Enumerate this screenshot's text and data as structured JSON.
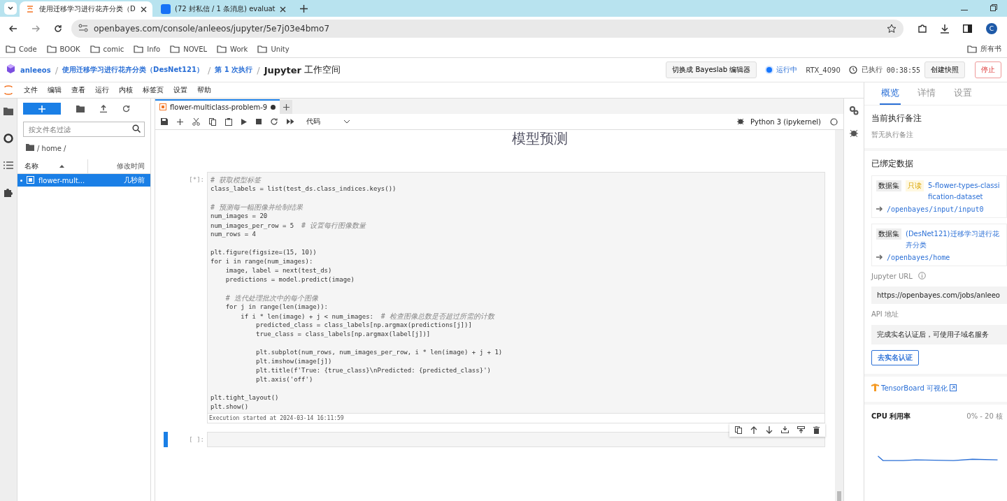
{
  "browser": {
    "tabs": [
      {
        "title": "使用迁移学习进行花卉分类（D",
        "selected": true
      },
      {
        "title": "(72 封私信 / 1 条消息) evaluat",
        "selected": false
      }
    ],
    "url": "openbayes.com/console/anleeos/jupyter/5e7j03e4bmo7",
    "avatar": "C",
    "bookmarks": [
      "Code",
      "BOOK",
      "comic",
      "Info",
      "NOVEL",
      "Work",
      "Unity"
    ],
    "other_bookmarks": "所有书"
  },
  "header": {
    "separator": "/",
    "crumbs": [
      {
        "text": "anleeos",
        "kind": "link"
      },
      {
        "text": "使用迁移学习进行花卉分类（DesNet121）",
        "kind": "link"
      },
      {
        "text": "第 1 次执行",
        "kind": "link"
      },
      {
        "text": "Jupyter",
        "kind": "plain"
      }
    ],
    "crumb_suffix": "工作空间",
    "switch_button": "切换成 Bayeslab 编辑器",
    "status": "运行中",
    "gpu": "RTX_4090",
    "elapsed_label": "已执行",
    "elapsed": "00:38:55",
    "snapshot_button": "创建快照",
    "stop_button": "停止"
  },
  "menu": [
    "文件",
    "编辑",
    "查看",
    "运行",
    "内核",
    "标签页",
    "设置",
    "帮助"
  ],
  "files": {
    "filter_placeholder": "按文件名过滤",
    "path": "/ home /",
    "columns": [
      "名称",
      "修改时间"
    ],
    "rows": [
      {
        "name": "flower-mult...",
        "modified": "几秒前",
        "selected": true
      }
    ]
  },
  "notebook": {
    "tab": "flower-multiclass-problem-9",
    "kind_select": "代码",
    "kernel": "Python 3 (ipykernel)",
    "heading": "模型预测",
    "cells": [
      {
        "prompt": "[*]:",
        "active": false,
        "blocks": [
          [
            {
              "comment": "# 获取模型标签"
            },
            {
              "code": "class_labels = list(test_ds.class_indices.keys())"
            }
          ],
          [
            {
              "comment": "# 预测每一幅图像并绘制结果"
            },
            {
              "code": "num_images = 20"
            },
            {
              "code": "num_images_per_row = 5  ",
              "comment": "# 设置每行图像数量"
            },
            {
              "code": "num_rows = 4"
            }
          ],
          [
            {
              "code": "plt.figure(figsize=(15, 10))"
            },
            {
              "code": "for i in range(num_images):"
            },
            {
              "code": "    image, label = next(test_ds)"
            },
            {
              "code": "    predictions = model.predict(image)"
            }
          ],
          [
            {
              "indented": true,
              "comment": "# 迭代处理批次中的每个图像"
            },
            {
              "code": "    for j in range(len(image)):"
            },
            {
              "code": "        if i * len(image) + j < num_images:  ",
              "comment": "# 检查图像总数是否超过所需的计数"
            },
            {
              "code": "            predicted_class = class_labels[np.argmax(predictions[j])]"
            },
            {
              "code": "            true_class = class_labels[np.argmax(label[j])]"
            }
          ],
          [
            {
              "code": "            plt.subplot(num_rows, num_images_per_row, i * len(image) + j + 1)"
            },
            {
              "code": "            plt.imshow(image[j])"
            },
            {
              "code": "            plt.title(f'True: {true_class}\\nPredicted: {predicted_class}')"
            },
            {
              "code": "            plt.axis('off')"
            }
          ],
          [
            {
              "code": "plt.tight_layout()"
            },
            {
              "code": "plt.show()"
            }
          ]
        ],
        "output": "Execution started at 2024-03-14 16:11:59"
      },
      {
        "prompt": "[ ]:",
        "active": true
      }
    ]
  },
  "panel": {
    "tabs": [
      {
        "label": "概览",
        "selected": true
      },
      {
        "label": "详情",
        "selected": false
      },
      {
        "label": "设置",
        "selected": false
      }
    ],
    "note_title": "当前执行备注",
    "note_text": "暂无执行备注",
    "bound_title": "已绑定数据",
    "datasets": [
      {
        "tag": "数据集",
        "readonly": true,
        "readonly_label": "只读",
        "name": "5-flower-types-classification-dataset",
        "path": "/openbayes/input/input0"
      },
      {
        "tag": "数据集",
        "readonly": false,
        "name": "(DesNet121)迁移学习进行花卉分类",
        "path": "/openbayes/home"
      }
    ],
    "jupyter_url_label": "Jupyter URL",
    "jupyter_url": "https://openbayes.com/jobs/anleeo",
    "api_label": "API 地址",
    "api_text": "完成实名认证后，可使用子域名服务",
    "verify_button": "去实名认证",
    "tensorboard": "TensorBoard 可视化",
    "cpu_label": "CPU 利用率",
    "cpu_range": "0% - 20 核"
  }
}
